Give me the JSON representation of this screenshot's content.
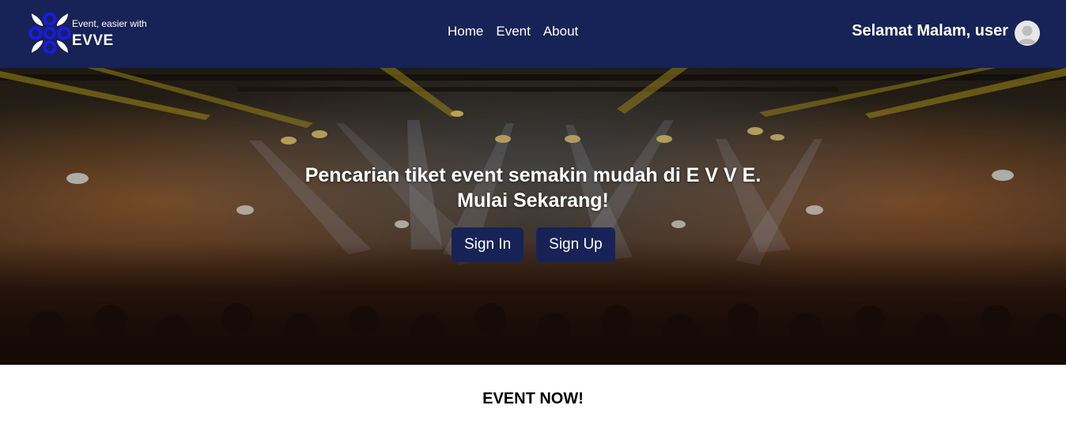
{
  "brand": {
    "tagline": "Event, easier with",
    "name": "EVVE",
    "logo_icon": "flower-logo-icon"
  },
  "nav": {
    "items": [
      {
        "label": "Home"
      },
      {
        "label": "Event"
      },
      {
        "label": "About"
      }
    ]
  },
  "user": {
    "greeting": "Selamat Malam, user",
    "avatar_icon": "user-avatar-icon"
  },
  "hero": {
    "line1": "Pencarian tiket event semakin mudah di E V V E.",
    "line2": "Mulai Sekarang!",
    "signin_label": "Sign In",
    "signup_label": "Sign Up",
    "background": "concert-stage-photo"
  },
  "section": {
    "title": "EVENT NOW!"
  },
  "colors": {
    "navbar": "#172356",
    "button": "#172356",
    "logo": "#1a1ae6"
  }
}
